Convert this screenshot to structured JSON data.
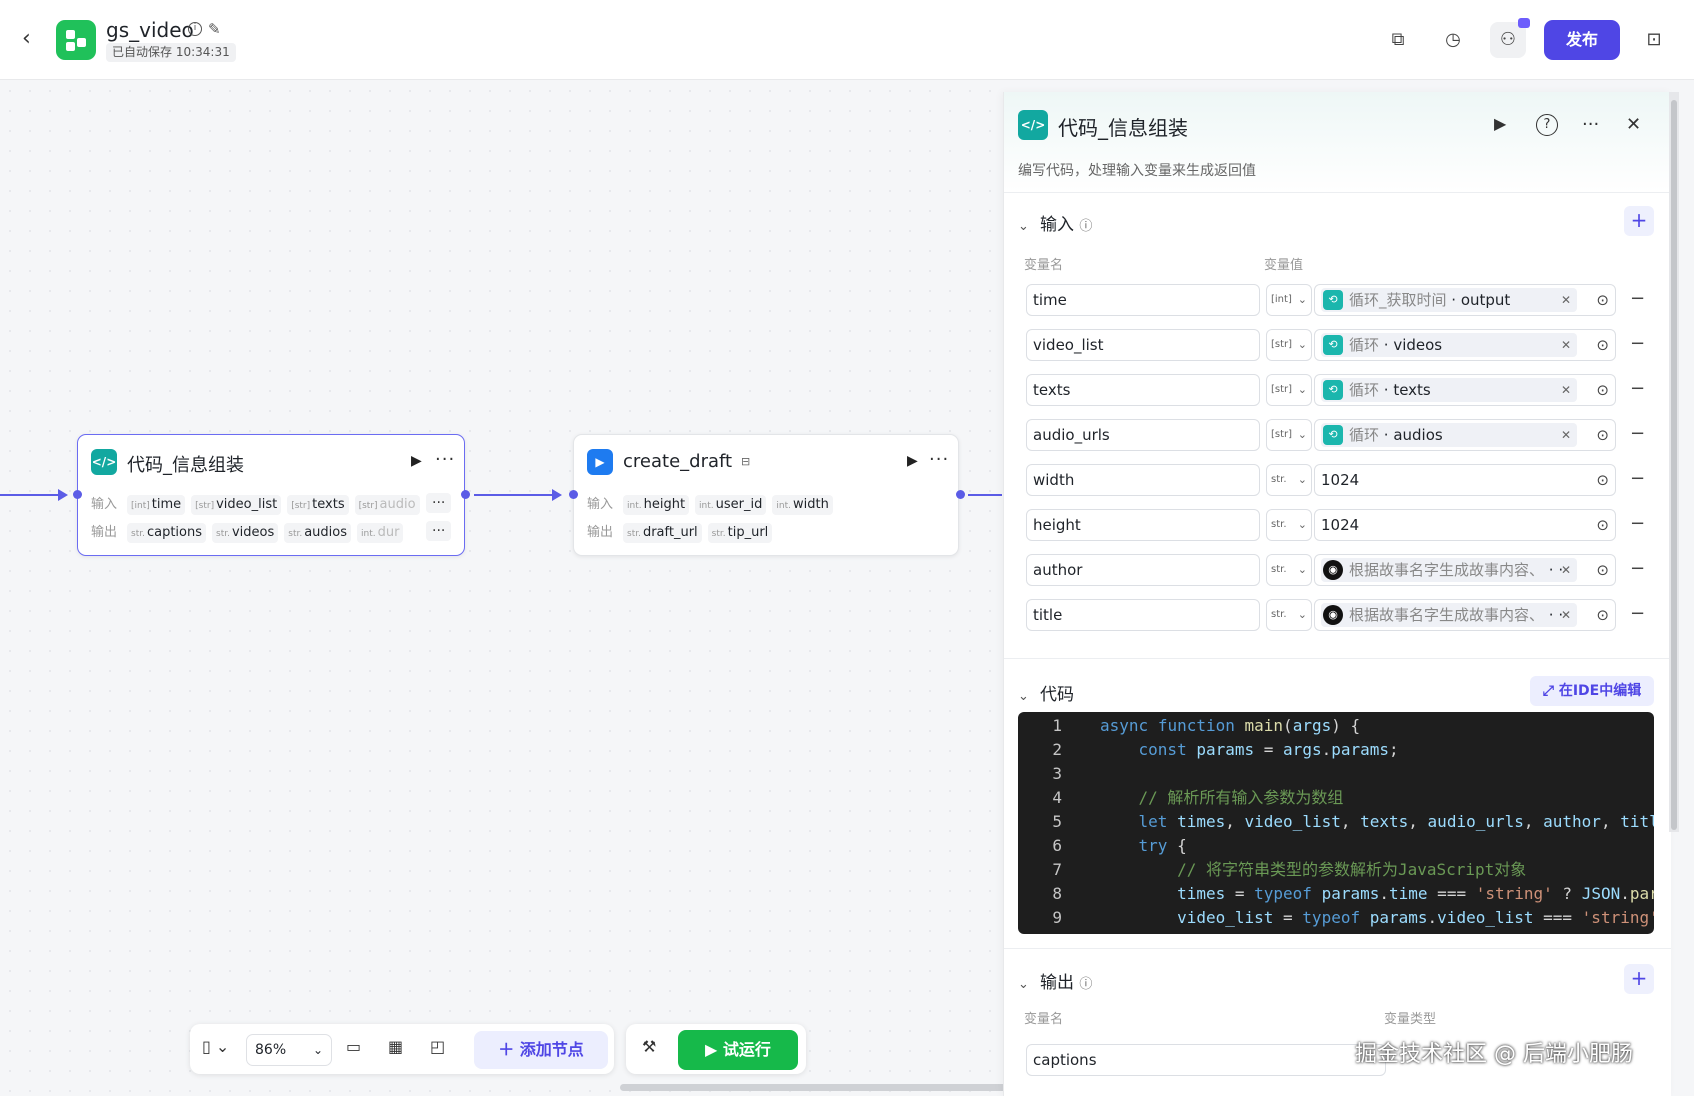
{
  "topbar": {
    "title": "gs_video",
    "autosave": "已自动保存 10:34:31",
    "publish_label": "发布",
    "colors": {
      "publish": "#4f46e5"
    }
  },
  "canvas": {
    "zoom": "86%",
    "add_node_label": "添加节点",
    "trial_run_label": "试运行"
  },
  "nodes": {
    "code_node": {
      "title": "代码_信息组装",
      "input_label": "输入",
      "output_label": "输出",
      "inputs": [
        {
          "type": "[int]",
          "name": "time"
        },
        {
          "type": "[str]",
          "name": "video_list"
        },
        {
          "type": "[str]",
          "name": "texts"
        },
        {
          "type": "[str]",
          "name": "audio"
        }
      ],
      "outputs": [
        {
          "type": "str.",
          "name": "captions"
        },
        {
          "type": "str.",
          "name": "videos"
        },
        {
          "type": "str.",
          "name": "audios"
        },
        {
          "type": "int.",
          "name": "dur"
        }
      ],
      "more": "···"
    },
    "draft_node": {
      "title": "create_draft",
      "input_label": "输入",
      "output_label": "输出",
      "inputs": [
        {
          "type": "int.",
          "name": "height"
        },
        {
          "type": "int.",
          "name": "user_id"
        },
        {
          "type": "int.",
          "name": "width"
        }
      ],
      "outputs": [
        {
          "type": "str.",
          "name": "draft_url"
        },
        {
          "type": "str.",
          "name": "tip_url"
        }
      ]
    }
  },
  "panel": {
    "title": "代码_信息组装",
    "description": "编写代码，处理输入变量来生成返回值",
    "input_section": "输入",
    "col_name": "变量名",
    "col_value": "变量值",
    "inputs": [
      {
        "name": "time",
        "type": "[int]",
        "kind": "ref",
        "src": "循环_获取时间",
        "field": "output",
        "icon": "loop"
      },
      {
        "name": "video_list",
        "type": "[str]",
        "kind": "ref",
        "src": "循环",
        "field": "videos",
        "icon": "loop"
      },
      {
        "name": "texts",
        "type": "[str]",
        "kind": "ref",
        "src": "循环",
        "field": "texts",
        "icon": "loop"
      },
      {
        "name": "audio_urls",
        "type": "[str]",
        "kind": "ref",
        "src": "循环",
        "field": "audios",
        "icon": "loop"
      },
      {
        "name": "width",
        "type": "str.",
        "kind": "literal",
        "value": "1024"
      },
      {
        "name": "height",
        "type": "str.",
        "kind": "literal",
        "value": "1024"
      },
      {
        "name": "author",
        "type": "str.",
        "kind": "ref",
        "src": "根据故事名字生成故事内容、",
        "field": "··",
        "icon": "llm"
      },
      {
        "name": "title",
        "type": "str.",
        "kind": "ref",
        "src": "根据故事名字生成故事内容、",
        "field": "··",
        "icon": "llm"
      }
    ],
    "code_section": "代码",
    "ide_label": "在IDE中编辑",
    "output_section": "输出",
    "col_type": "变量类型",
    "outputs": [
      {
        "name": "captions"
      }
    ]
  },
  "code_lines": [
    "1",
    "2",
    "3",
    "4",
    "5",
    "6",
    "7",
    "8",
    "9"
  ],
  "watermark": "掘金技术社区 @ 后端小肥肠"
}
